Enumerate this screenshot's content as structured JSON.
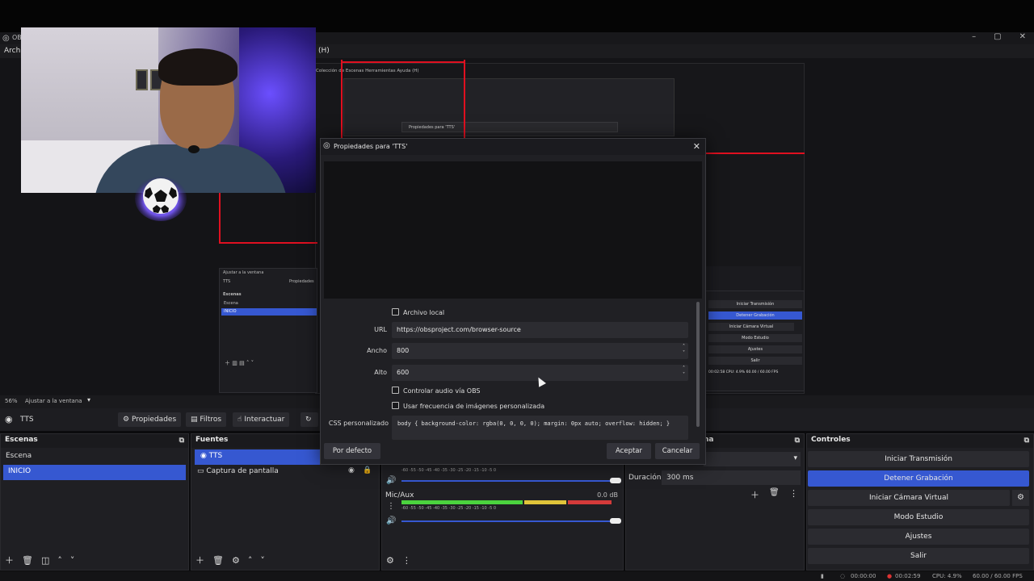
{
  "window": {
    "title_short": "OB",
    "menu": {
      "archivo": "Archi",
      "ayuda_key": "(H)"
    }
  },
  "nested_preview": {
    "menu_text": "Colección de Escenas   Herramientas   Ayuda (H)",
    "dialog_title": "Propiedades para 'TTS'",
    "mini_scene_label": "Ajustar a la ventana",
    "mini_source": "TTS",
    "mini_props": "Propiedades",
    "mini_dock_title": "Escenas",
    "mini_scenes": [
      "Escena",
      "INICIO"
    ],
    "mini_controls": [
      "Iniciar Transmisión",
      "Detener Grabación",
      "Iniciar Cámara Virtual",
      "Modo Estudio",
      "Ajustes",
      "Salir"
    ],
    "mini_status": "00:02:58   CPU: 4.9%   60.00 / 60.00 FPS"
  },
  "scene_bar": {
    "zoom": "56%",
    "fit_label": "Ajustar a la ventana"
  },
  "source_bar": {
    "name": "TTS",
    "buttons": {
      "propiedades": "Propiedades",
      "filtros": "Filtros",
      "interactuar": "Interactuar"
    }
  },
  "docks": {
    "escenas": {
      "title": "Escenas",
      "items": [
        "Escena",
        "INICIO"
      ]
    },
    "fuentes": {
      "title": "Fuentes",
      "items": [
        "TTS",
        "Captura de pantalla"
      ]
    },
    "transitions": {
      "title_partial": "na",
      "duration_label": "Duración",
      "duration_value": "300 ms"
    },
    "controles": {
      "title": "Controles",
      "buttons": [
        "Iniciar Transmisión",
        "Detener Grabación",
        "Iniciar Cámara Virtual",
        "Modo Estudio",
        "Ajustes",
        "Salir"
      ]
    }
  },
  "audio": {
    "mic_label": "Mic/Aux",
    "mic_db": "0.0 dB",
    "ticks": "-60  -55  -50  -45  -40  -35  -30  -25  -20  -15  -10  -5  0",
    "mic_level": 0.92
  },
  "status": {
    "rec_idle": "00:00:00",
    "rec_time": "00:02:59",
    "cpu": "CPU: 4.9%",
    "fps": "60.00 / 60.00 FPS"
  },
  "dialog": {
    "title": "Propiedades para 'TTS'",
    "archivo_local": "Archivo local",
    "url_label": "URL",
    "url_value": "https://obsproject.com/browser-source",
    "ancho_label": "Ancho",
    "ancho_value": "800",
    "alto_label": "Alto",
    "alto_value": "600",
    "controlar_audio": "Controlar audio vía OBS",
    "usar_frecuencia": "Usar frecuencia de imágenes personalizada",
    "css_label": "CSS personalizado",
    "css_value": "body { background-color: rgba(0, 0, 0, 0); margin: 0px auto; overflow: hidden; }",
    "buttons": {
      "defaults": "Por defecto",
      "accept": "Aceptar",
      "cancel": "Cancelar"
    }
  },
  "colors": {
    "accent": "#3658d1",
    "red_overlay": "#e01020",
    "bg": "#1f1f23"
  }
}
